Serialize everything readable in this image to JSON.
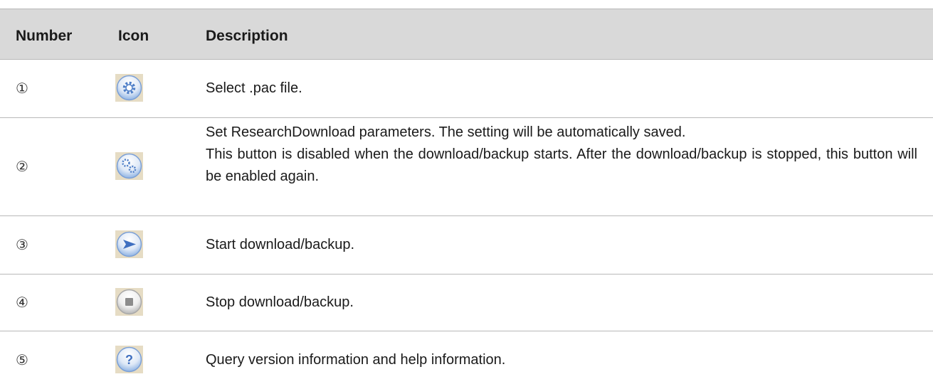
{
  "table": {
    "headers": {
      "number": "Number",
      "icon": "Icon",
      "description": "Description"
    },
    "rows": [
      {
        "number": "①",
        "icon": "gear-icon",
        "description": "Select .pac file."
      },
      {
        "number": "②",
        "icon": "settings-gears-icon",
        "description_line1": "Set ResearchDownload parameters. The setting will be automatically saved.",
        "description_line2": "This button is disabled when the download/backup starts. After the download/backup is stopped, this button will be enabled again."
      },
      {
        "number": "③",
        "icon": "play-arrow-icon",
        "description": "Start download/backup."
      },
      {
        "number": "④",
        "icon": "stop-square-icon",
        "description": "Stop download/backup."
      },
      {
        "number": "⑤",
        "icon": "help-question-icon",
        "description": "Query version information and help information."
      }
    ]
  },
  "colors": {
    "header_bg": "#d9d9d9",
    "icon_blue": "#7ea6dc",
    "rule": "#b8b8b8"
  }
}
